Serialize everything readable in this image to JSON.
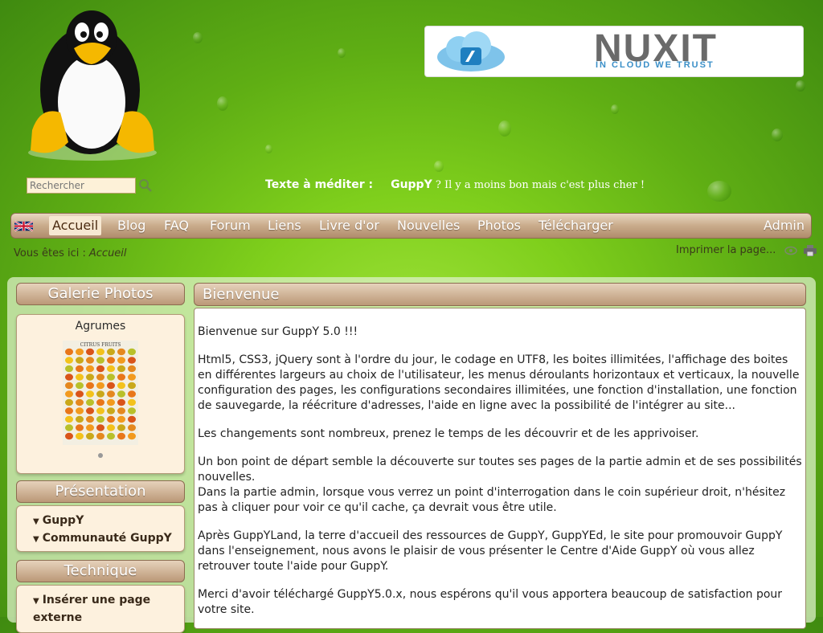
{
  "search": {
    "placeholder": "Rechercher"
  },
  "banner": {
    "brand": "NUXIT",
    "slogan": "IN CLOUD WE TRUST"
  },
  "quote": {
    "label": "Texte à méditer :",
    "author": "GuppY",
    "text": " ? Il y a moins bon mais c'est plus cher !"
  },
  "menu": {
    "items": [
      "Accueil",
      "Blog",
      "FAQ",
      "Forum",
      "Liens",
      "Livre d'or",
      "Nouvelles",
      "Photos",
      "Télécharger"
    ],
    "admin": "Admin"
  },
  "breadcrumb": {
    "prefix": "Vous êtes ici :",
    "current": "Accueil"
  },
  "print": {
    "label": "Imprimer la page..."
  },
  "sidebar": {
    "galerie": {
      "title": "Galerie Photos",
      "caption": "Agrumes",
      "image_title": "CITRUS FRUITS"
    },
    "presentation": {
      "title": "Présentation",
      "items": [
        "GuppY",
        "Communauté GuppY"
      ]
    },
    "technique": {
      "title": "Technique",
      "items": [
        "Insérer une page externe"
      ]
    }
  },
  "main": {
    "title": "Bienvenue",
    "paragraphs": [
      "Bienvenue sur GuppY 5.0 !!!",
      "Html5, CSS3, jQuery sont à l'ordre du jour, le codage en UTF8, les boites illimitées, l'affichage des boites en différentes largeurs au choix de l'utilisateur, les menus déroulants horizontaux et verticaux, la nouvelle configuration des pages, les configurations secondaires illimitées, une fonction d'installation, une fonction de sauvegarde, la réécriture d'adresses, l'aide en ligne avec la possibilité de l'intégrer au site...",
      "Les changements sont nombreux, prenez le temps de les découvrir et de les apprivoiser.",
      "Un bon point de départ semble la découverte sur toutes ses pages de la partie admin et de ses possibilités nouvelles.",
      "Dans la partie admin, lorsque vous verrez un point d'interrogation dans le coin supérieur droit, n'hésitez pas à cliquer pour voir ce qu'il cache, ça devrait vous être utile.",
      "Après GuppYLand, la terre d'accueil des ressources de GuppY, GuppYEd, le site pour promouvoir GuppY dans l'enseignement, nous avons le plaisir de vous présenter le Centre d'Aide GuppY où vous allez retrouver toute l'aide pour GuppY.",
      "Merci d'avoir téléchargé GuppY5.0.x, nous espérons qu'il vous apportera beaucoup de satisfaction pour votre site."
    ]
  }
}
